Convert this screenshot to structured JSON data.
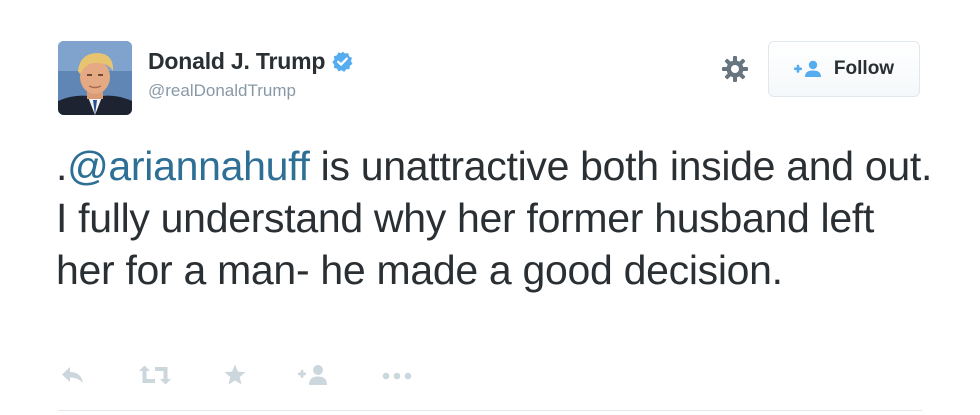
{
  "user": {
    "display_name": "Donald J. Trump",
    "handle": "@realDonaldTrump",
    "verified": true,
    "avatar_icon": "profile-photo"
  },
  "header": {
    "settings_icon": "gear-icon",
    "follow_label": "Follow",
    "follow_icon": "add-user-icon"
  },
  "tweet": {
    "prefix": ".",
    "mention": "@ariannahuff",
    "text": " is unattractive both inside and out. I fully understand why her former husband left her for a man- he made a good decision."
  },
  "actions": [
    {
      "name": "reply",
      "icon": "reply-icon"
    },
    {
      "name": "retweet",
      "icon": "retweet-icon"
    },
    {
      "name": "favorite",
      "icon": "star-icon"
    },
    {
      "name": "follow",
      "icon": "add-user-icon"
    },
    {
      "name": "more",
      "icon": "more-icon"
    }
  ],
  "colors": {
    "text": "#292f33",
    "mention": "#2e6f96",
    "muted": "#8899a6",
    "verified": "#55acee",
    "action_icons": "#ccd6dd"
  }
}
